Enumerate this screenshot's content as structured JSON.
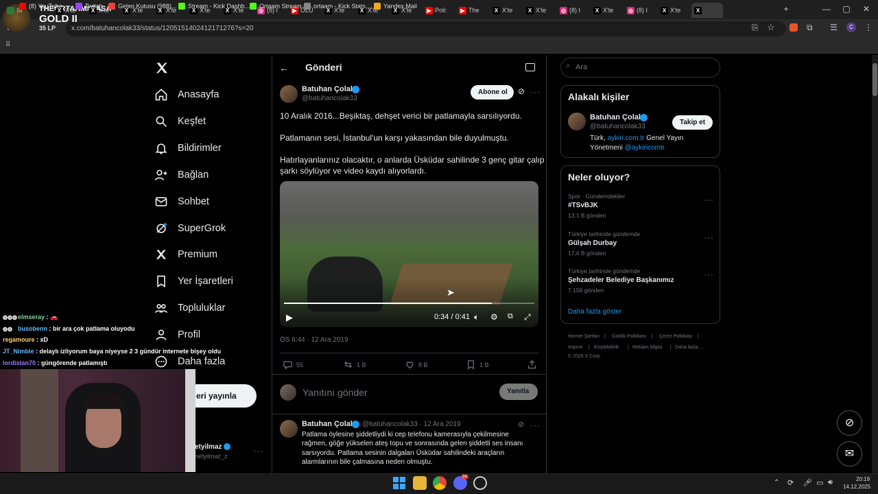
{
  "browser": {
    "tabs": [
      {
        "label": "St",
        "icon": "stream-icon",
        "color": "#2a7a3b"
      },
      {
        "label": "X'te",
        "icon": "x-icon",
        "color": "#000000"
      },
      {
        "label": "X'te",
        "icon": "x-icon",
        "color": "#000000"
      },
      {
        "label": "X'te",
        "icon": "x-icon",
        "color": "#000000"
      },
      {
        "label": "X'te",
        "icon": "x-icon",
        "color": "#000000"
      },
      {
        "label": "X'te",
        "icon": "x-icon",
        "color": "#000000"
      },
      {
        "label": "X'te",
        "icon": "x-icon",
        "color": "#000000"
      },
      {
        "label": "(8) I",
        "icon": "instagram-icon",
        "color": "#d62976"
      },
      {
        "label": "ÖLÜ",
        "icon": "youtube-icon",
        "color": "#ff0000"
      },
      {
        "label": "X'te",
        "icon": "x-icon",
        "color": "#000000"
      },
      {
        "label": "X'te",
        "icon": "x-icon",
        "color": "#000000"
      },
      {
        "label": "X'te",
        "icon": "x-icon",
        "color": "#000000"
      },
      {
        "label": "Poli:",
        "icon": "youtube-icon",
        "color": "#ff0000"
      },
      {
        "label": "The",
        "icon": "youtube-icon",
        "color": "#ff0000"
      },
      {
        "label": "X'te",
        "icon": "x-icon",
        "color": "#000000"
      },
      {
        "label": "X'te",
        "icon": "x-icon",
        "color": "#000000"
      },
      {
        "label": "(8) I",
        "icon": "instagram-icon",
        "color": "#d62976"
      },
      {
        "label": "X'te",
        "icon": "x-icon",
        "color": "#000000"
      },
      {
        "label": "(8) I",
        "icon": "instagram-icon",
        "color": "#d62976"
      },
      {
        "label": "X'te",
        "icon": "x-icon",
        "color": "#000000"
      },
      {
        "label": "",
        "icon": "x-icon",
        "color": "#000000"
      }
    ],
    "url": "x.com/batuhancolak33/status/1205151402412171276?s=20",
    "bookmarks": [
      {
        "label": "(8) YouTube",
        "color": "#ff0000"
      },
      {
        "label": "Twitch",
        "color": "#9146ff"
      },
      {
        "label": "Gelen Kutusu (988)...",
        "color": "#ea4335"
      },
      {
        "label": "Stream - Kick Dashb...",
        "color": "#53fc18"
      },
      {
        "label": "Ortaam Stream",
        "color": "#53fc18"
      },
      {
        "label": "ortaam - Kick Stats,...",
        "color": "#888888"
      },
      {
        "label": "Yandex Mail",
        "color": "#f5a623"
      }
    ]
  },
  "overlay": {
    "streamer": "THEORTAAM#PASA",
    "rank": "GOLD II",
    "lp": "35 LP"
  },
  "sidebar": {
    "items": [
      {
        "label": "Anasayfa"
      },
      {
        "label": "Keşfet"
      },
      {
        "label": "Bildirimler"
      },
      {
        "label": "Bağlan"
      },
      {
        "label": "Sohbet"
      },
      {
        "label": "SuperGrok"
      },
      {
        "label": "Premium"
      },
      {
        "label": "Yer İşaretleri"
      },
      {
        "label": "Topluluklar"
      },
      {
        "label": "Profil"
      },
      {
        "label": "Daha fazla"
      }
    ],
    "post_button": "eri yayınla",
    "account_name": "etyilmaz",
    "account_handle": "netyilmaz_z"
  },
  "header": {
    "title": "Gönderi"
  },
  "tweet": {
    "name": "Batuhan Çolak",
    "handle": "@batuhancolak33",
    "follow": "Abone ol",
    "paragraphs": [
      "10 Aralık 2016...Beşiktaş, dehşet verici bir patlamayla sarsılıyordu.",
      "Patlamanın sesi, İstanbul'un karşı yakasından bile duyulmuştu.",
      "Hatırlayanlarınız olacaktır, o anlarda Üsküdar sahilinde 3 genç gitar çalıp",
      "şarkı söylüyor ve video kaydı alıyorlardı."
    ],
    "video_time": "0:34 / 0:41",
    "video_progress": 0.83,
    "timestamp": "ÖS 6:44 · 12 Ara 2019",
    "replies": "55",
    "retweets": "1 B",
    "likes": "8 B",
    "bookmarks": "1 B"
  },
  "reply_box": {
    "placeholder": "Yanıtını gönder",
    "button": "Yanıtla"
  },
  "reply": {
    "name": "Batuhan Çolak",
    "meta": "@batuhancolak33 · 12 Ara 2019",
    "lines": [
      "Patlama öylesine şiddetliydi ki cep telefonu kamerasıyla çekilmesine",
      "rağmen, göğe yükselen ateş topu ve sonrasında gelen şiddetli ses insanı",
      "sarsıyordu. Patlama sesinin dalgaları Üsküdar sahilindeki araçların",
      "alarmlarının bile çalmasına neden olmuştu."
    ]
  },
  "search": {
    "placeholder": "Ara"
  },
  "related": {
    "title": "Alakalı kişiler",
    "name": "Batuhan Çolak",
    "handle": "@batuhancolak33",
    "follow": "Takip et",
    "bio_a": "Türk, ",
    "bio_link": "aykiri.com.tr",
    "bio_b": " Genel Yayın",
    "bio_c": "Yönetmeni ",
    "bio_mention": "@aykiricomtr"
  },
  "trends": {
    "title": "Neler oluyor?",
    "items": [
      {
        "category": "Spor · Gündemdekiler",
        "name": "#TSvBJK",
        "count": "13,1 B gönderi"
      },
      {
        "category": "Türkiye tarihinde gündemde",
        "name": "Gülşah Durbay",
        "count": "17,6 B gönderi"
      },
      {
        "category": "Türkiye tarihinde gündemde",
        "name": "Şehzadeler Belediye Başkanımız",
        "count": "7.158 gönderi"
      }
    ],
    "more": "Daha fazla göster"
  },
  "footer": {
    "row1": [
      "Hizmet Şartları",
      "|",
      "Gizlilik Politikası",
      "|",
      "Çerez Politikası",
      "|"
    ],
    "row2": [
      "Imprint",
      "|",
      "Erişilebilirlik",
      "|",
      "Reklam bilgisi",
      "|",
      "Daha fazla ..."
    ],
    "copyright": "© 2025 X Corp."
  },
  "chat": [
    {
      "user": "elmseray",
      "text": " : 🚗",
      "color": "#7fd4a0"
    },
    {
      "user": "busobenn",
      "text": " : bir ara çok patlama oluyodu",
      "color": "#5fb8ff"
    },
    {
      "user": "regamoure",
      "text": " : xD",
      "color": "#ffd36b"
    },
    {
      "user": "JT_Nimble",
      "text": " : delaylı izliyorum baya niyeyse 2 3 gündür internete bişey oldu",
      "color": "#5fb8ff"
    },
    {
      "user": "lordistan70",
      "text": " : güngörende patlamıştı",
      "color": "#9b7bff"
    }
  ],
  "taskbar": {
    "time": "20:19",
    "date": "14.12.2025",
    "badge": "24"
  }
}
